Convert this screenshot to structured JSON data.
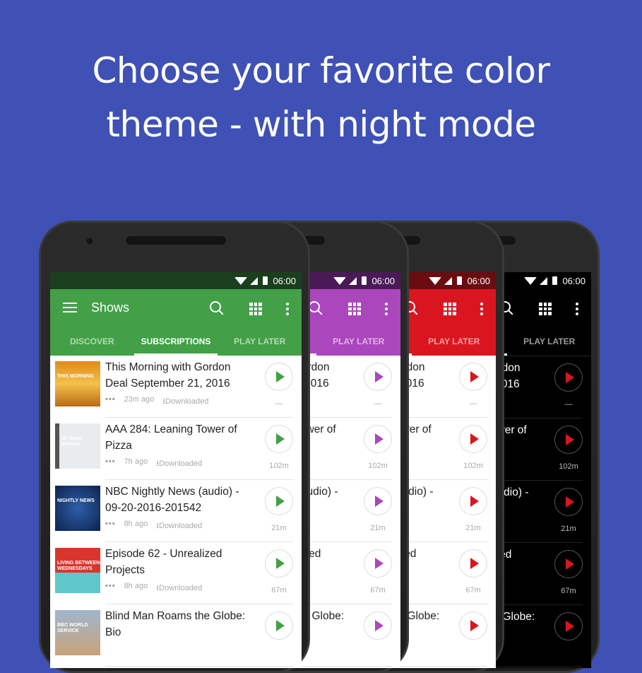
{
  "headline": {
    "line1": "Choose your favorite color",
    "line2": "theme - with night mode"
  },
  "phones": [
    {
      "theme": "green",
      "statusbar_color": "#1b3f1e",
      "primary_color": "#43a047",
      "accent_color": "#43a047",
      "dark": false
    },
    {
      "theme": "purple",
      "statusbar_color": "#4a1a57",
      "primary_color": "#ab47bc",
      "accent_color": "#ab47bc",
      "dark": false
    },
    {
      "theme": "red",
      "statusbar_color": "#6a0d11",
      "primary_color": "#d9161f",
      "accent_color": "#d9161f",
      "dark": false
    },
    {
      "theme": "night",
      "statusbar_color": "#000000",
      "primary_color": "#000000",
      "accent_color": "#d9161f",
      "dark": true
    }
  ],
  "status": {
    "time": "06:00"
  },
  "toolbar": {
    "title": "Shows"
  },
  "tabs": [
    {
      "label": "DISCOVER",
      "active": false
    },
    {
      "label": "SUBSCRIPTIONS",
      "active": true
    },
    {
      "label": "PLAY LATER",
      "active": false
    }
  ],
  "episodes": [
    {
      "title": "This Morning with Gordon Deal September 21, 2016",
      "age": "23m ago",
      "status": "Downloaded",
      "duration": "—",
      "art_label": "THIS MORNING"
    },
    {
      "title": "AAA 284: Leaning Tower of Pizza",
      "age": "7h ago",
      "status": "Downloaded",
      "duration": "102m",
      "art_label": "all about android"
    },
    {
      "title": "NBC Nightly News (audio) - 09-20-2016-201542",
      "age": "8h ago",
      "status": "Downloaded",
      "duration": "21m",
      "art_label": "NIGHTLY NEWS"
    },
    {
      "title": "Episode 62 - Unrealized Projects",
      "age": "8h ago",
      "status": "Downloaded",
      "duration": "67m",
      "art_label": "LIVING BETWEEN WEDNESDAYS"
    },
    {
      "title": "Blind Man Roams the Globe: Bio",
      "age": "",
      "status": "",
      "duration": "",
      "art_label": "BBC WORLD SERVICE"
    }
  ],
  "icons": {
    "menu": "hamburger-icon",
    "search": "search-icon",
    "grid": "grid-view-icon",
    "more": "more-vert-icon",
    "play": "play-icon",
    "download": "download-icon",
    "overflow": "dots-icon"
  },
  "download_glyph": "⭳"
}
